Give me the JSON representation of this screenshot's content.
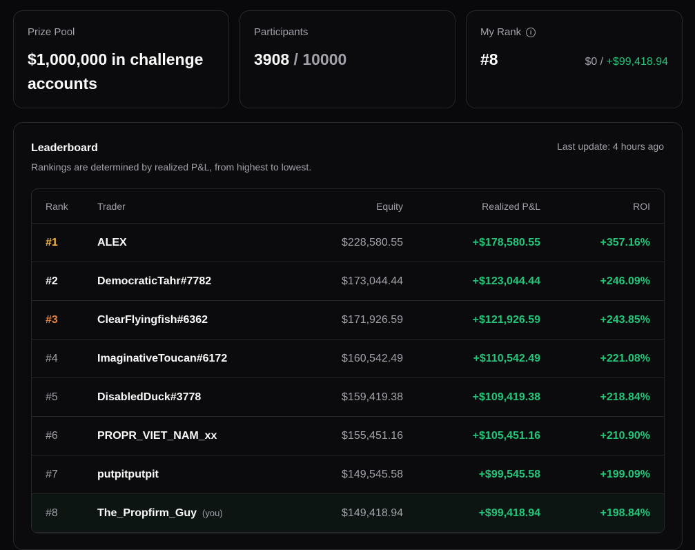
{
  "stats": {
    "prize_pool": {
      "label": "Prize Pool",
      "value": "$1,000,000 in challenge accounts"
    },
    "participants": {
      "label": "Participants",
      "current": "3908",
      "separator": " / ",
      "total": "10000"
    },
    "my_rank": {
      "label": "My Rank",
      "info_icon": "i",
      "rank": "#8",
      "balance": "$0 /",
      "pnl": "+$99,418.94"
    }
  },
  "leaderboard": {
    "title": "Leaderboard",
    "subtitle": "Rankings are determined by realized P&L, from highest to lowest.",
    "last_update": "Last update: 4 hours ago",
    "columns": {
      "rank": "Rank",
      "trader": "Trader",
      "equity": "Equity",
      "pnl": "Realized P&L",
      "roi": "ROI"
    },
    "rows": [
      {
        "rank": "#1",
        "tier": "gold",
        "trader": "ALEX",
        "equity": "$228,580.55",
        "pnl": "+$178,580.55",
        "roi": "+357.16%"
      },
      {
        "rank": "#2",
        "tier": "silver",
        "trader": "DemocraticTahr#7782",
        "equity": "$173,044.44",
        "pnl": "+$123,044.44",
        "roi": "+246.09%"
      },
      {
        "rank": "#3",
        "tier": "bronze",
        "trader": "ClearFlyingfish#6362",
        "equity": "$171,926.59",
        "pnl": "+$121,926.59",
        "roi": "+243.85%"
      },
      {
        "rank": "#4",
        "tier": "",
        "trader": "ImaginativeToucan#6172",
        "equity": "$160,542.49",
        "pnl": "+$110,542.49",
        "roi": "+221.08%"
      },
      {
        "rank": "#5",
        "tier": "",
        "trader": "DisabledDuck#3778",
        "equity": "$159,419.38",
        "pnl": "+$109,419.38",
        "roi": "+218.84%"
      },
      {
        "rank": "#6",
        "tier": "",
        "trader": "PROPR_VIET_NAM_xx",
        "equity": "$155,451.16",
        "pnl": "+$105,451.16",
        "roi": "+210.90%"
      },
      {
        "rank": "#7",
        "tier": "",
        "trader": "putpitputpit",
        "equity": "$149,545.58",
        "pnl": "+$99,545.58",
        "roi": "+199.09%"
      },
      {
        "rank": "#8",
        "tier": "",
        "trader": "The_Propfirm_Guy",
        "you": "(you)",
        "equity": "$149,418.94",
        "pnl": "+$99,418.94",
        "roi": "+198.84%"
      }
    ]
  }
}
